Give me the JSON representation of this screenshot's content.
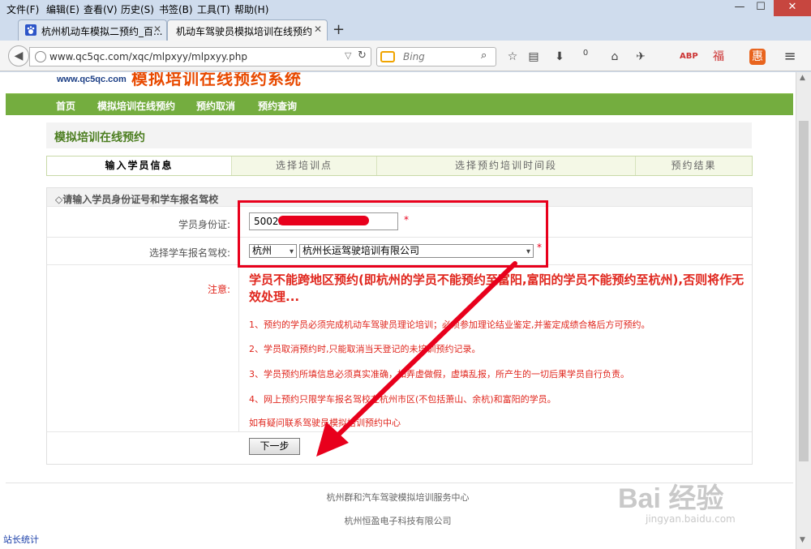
{
  "menu": [
    "文件(F)",
    "编辑(E)",
    "查看(V)",
    "历史(S)",
    "书签(B)",
    "工具(T)",
    "帮助(H)"
  ],
  "window_controls": {
    "minimize": "—",
    "maximize": "☐",
    "close": "✕"
  },
  "tabs": [
    {
      "label": "杭州机动车模拟二预约_百...",
      "active": false
    },
    {
      "label": "机动车驾驶员模拟培训在线预约",
      "active": true
    }
  ],
  "new_tab_label": "+",
  "nav": {
    "url": "www.qc5qc.com/xqc/mlpxyy/mlpxyy.php",
    "search_placeholder": "Bing",
    "download_count": "0"
  },
  "site": {
    "logo_url": "www.qc5qc.com",
    "logo_title": "模拟培训在线预约系统",
    "nav_items": [
      "首页",
      "模拟培训在线预约",
      "预约取消",
      "预约查询"
    ],
    "section_title": "模拟培训在线预约",
    "steps": [
      "输入学员信息",
      "选择培训点",
      "选择预约培训时间段",
      "预约结果"
    ],
    "form_head": "◇请输入学员身份证号和学车报名驾校",
    "id_label": "学员身份证:",
    "id_value": "50022",
    "school_label": "选择学车报名驾校:",
    "city_value": "杭州",
    "school_value": "杭州长运驾驶培训有限公司",
    "required_mark": "*",
    "note_label": "注意:",
    "warning": "学员不能跨地区预约(即杭州的学员不能预约至富阳,富阳的学员不能预约至杭州),否则将作无效处理...",
    "rules": [
      "1、预约的学员必须完成机动车驾驶员理论培训；必须参加理论结业鉴定,并鉴定成绩合格后方可预约。",
      "2、学员取消预约时,只能取消当天登记的未培训预约记录。",
      "3、学员预约所填信息必须真实准确，如弄虚做假，虚填乱报，所产生的一切后果学员自行负责。",
      "4、网上预约只限学车报名驾校在杭州市区(不包括萧山、余杭)和富阳的学员。"
    ],
    "contact": "如有疑问联系驾驶员模拟培训预约中心",
    "next_button": "下一步",
    "footer": [
      "杭州群和汽车驾驶模拟培训服务中心",
      "杭州恒盈电子科技有限公司"
    ],
    "stats_link": "站长统计"
  },
  "watermark": {
    "main": "Bai 经验",
    "sub": "jingyan.baidu.com"
  },
  "colors": {
    "accent_green": "#74ad3f",
    "title_orange": "#e84a00",
    "warning_red": "#e0261d",
    "annotation_red": "#e8001c"
  }
}
